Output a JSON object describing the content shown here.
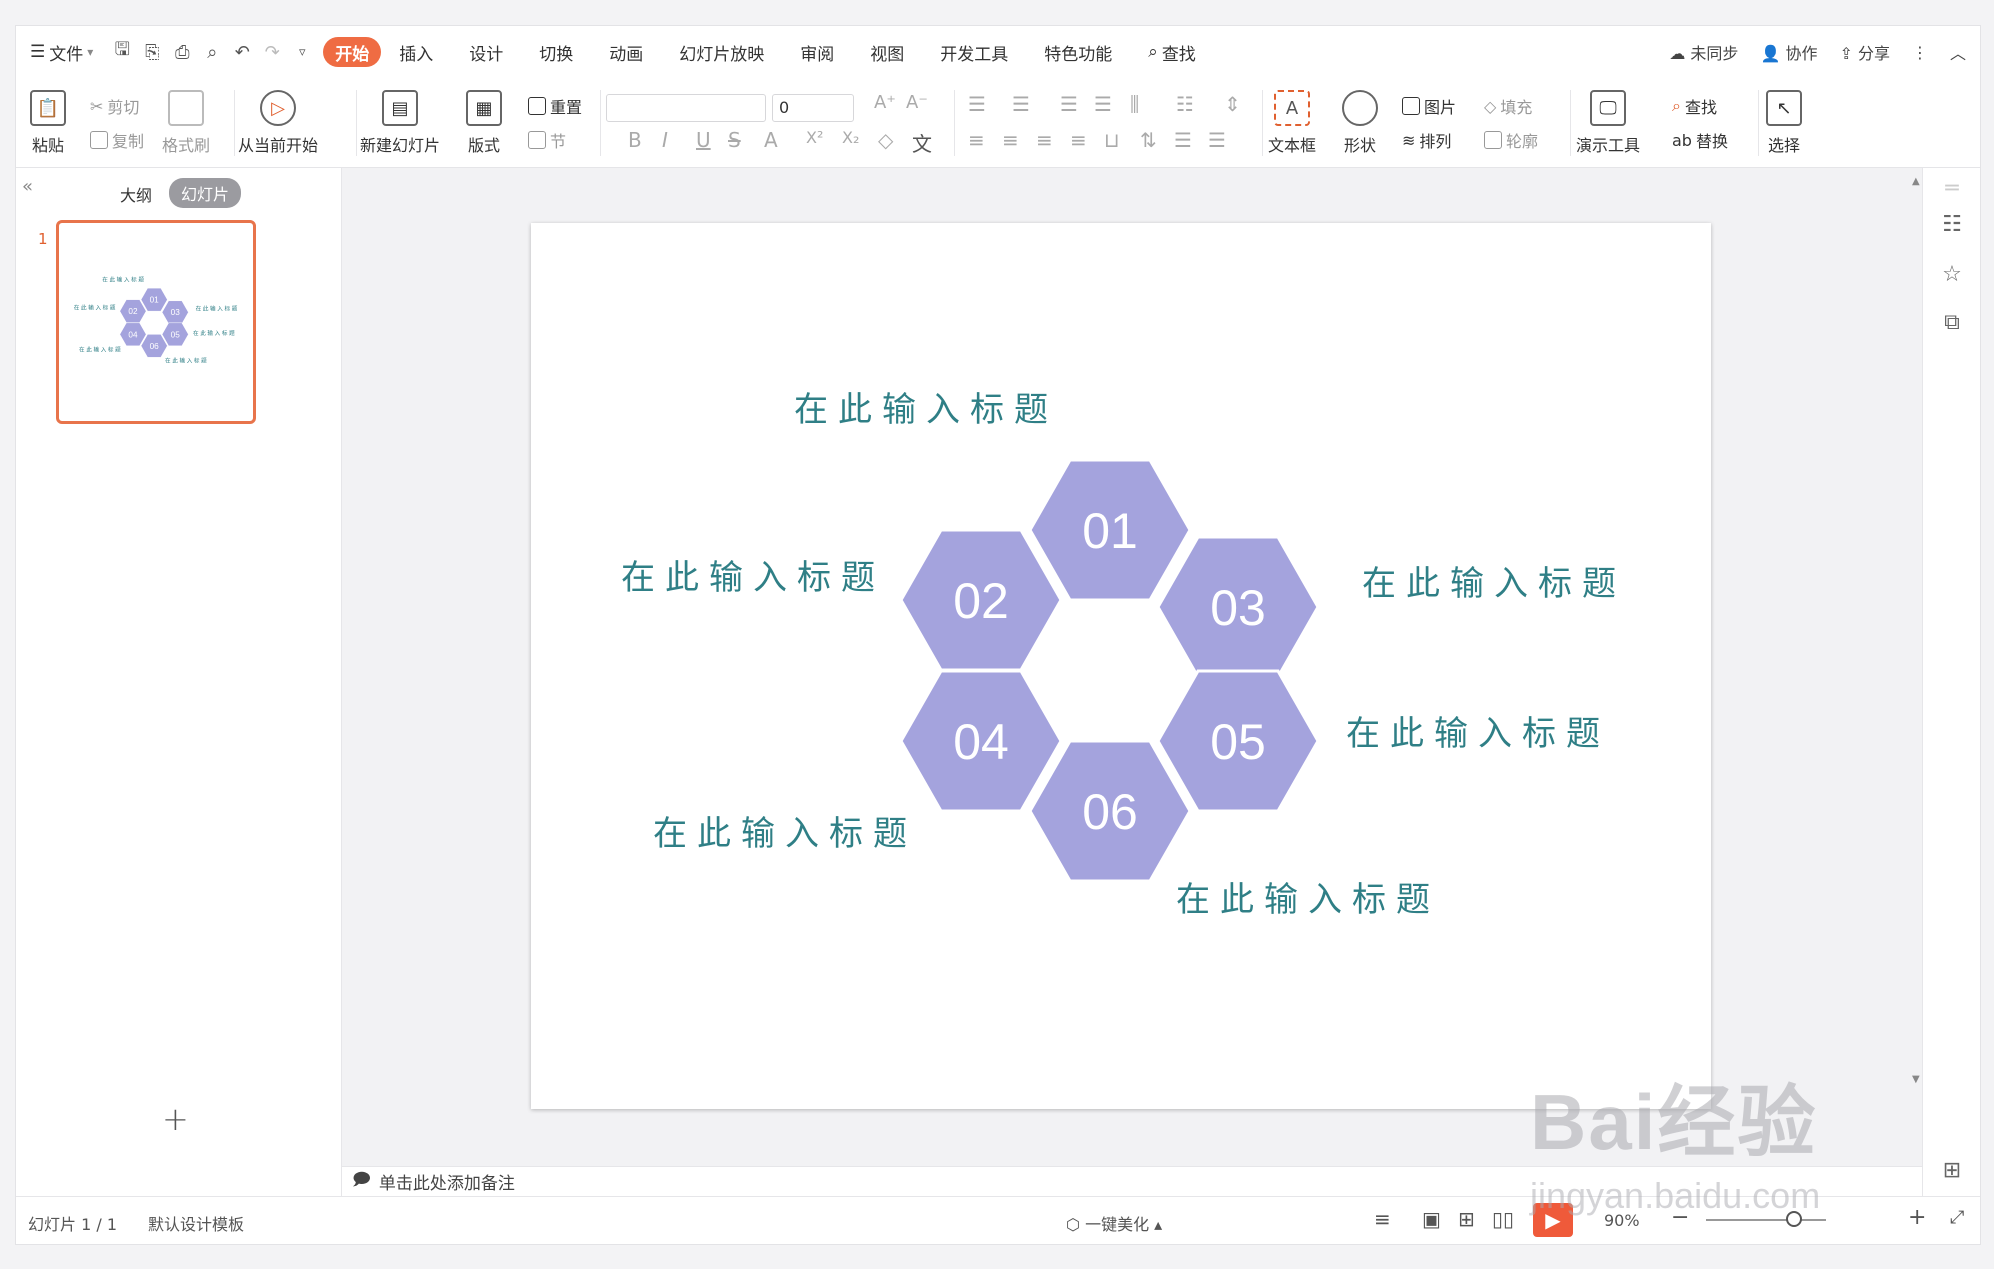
{
  "menu": {
    "file_label": "文件",
    "tabs": [
      "开始",
      "插入",
      "设计",
      "切换",
      "动画",
      "幻灯片放映",
      "审阅",
      "视图",
      "开发工具",
      "特色功能"
    ],
    "active_tab": "开始",
    "search_label": "查找",
    "right": {
      "sync": "未同步",
      "collab": "协作",
      "share": "分享"
    }
  },
  "ribbon": {
    "paste": "粘贴",
    "cut": "剪切",
    "copy": "复制",
    "format_painter": "格式刷",
    "from_current": "从当前开始",
    "new_slide": "新建幻灯片",
    "layout": "版式",
    "reset": "重置",
    "section": "节",
    "font_size": "0",
    "textbox": "文本框",
    "shape": "形状",
    "picture": "图片",
    "fill": "填充",
    "arrange": "排列",
    "outline": "轮廓",
    "present_tool": "演示工具",
    "find": "查找",
    "replace": "替换",
    "select": "选择"
  },
  "left_panel": {
    "outline_tab": "大纲",
    "slides_tab": "幻灯片",
    "slide_number": "1"
  },
  "slide": {
    "hex_labels": [
      "01",
      "02",
      "03",
      "04",
      "05",
      "06"
    ],
    "titles": [
      "在此输入标题",
      "在此输入标题",
      "在此输入标题",
      "在此输入标题",
      "在此输入标题",
      "在此输入标题"
    ],
    "hex_color": "#a4a3dd",
    "title_color": "#2f7f86"
  },
  "notes": {
    "placeholder": "单击此处添加备注"
  },
  "status": {
    "slide_count": "幻灯片 1 / 1",
    "template": "默认设计模板",
    "beautify": "一键美化",
    "zoom": "90%"
  },
  "watermark": {
    "brand": "Bai经验",
    "url": "jingyan.baidu.com"
  }
}
